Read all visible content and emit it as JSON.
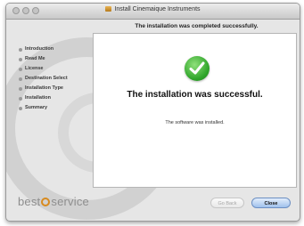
{
  "window": {
    "title": "Install Cinemaique Instruments",
    "header_message": "The installation was completed successfully."
  },
  "sidebar": {
    "steps": [
      {
        "label": "Introduction"
      },
      {
        "label": "Read Me"
      },
      {
        "label": "License"
      },
      {
        "label": "Destination Select"
      },
      {
        "label": "Installation Type"
      },
      {
        "label": "Installation"
      },
      {
        "label": "Summary"
      }
    ]
  },
  "main": {
    "icon": "checkmark-icon",
    "success_title": "The installation was successful.",
    "success_detail": "The software was installed."
  },
  "footer": {
    "logo_text_before": "best",
    "logo_text_after": "service",
    "back_label": "Go Back",
    "close_label": "Close"
  },
  "colors": {
    "success_green": "#2fa52a",
    "logo_orange": "#d88a1e",
    "default_button_blue": "#9fc1ec"
  }
}
